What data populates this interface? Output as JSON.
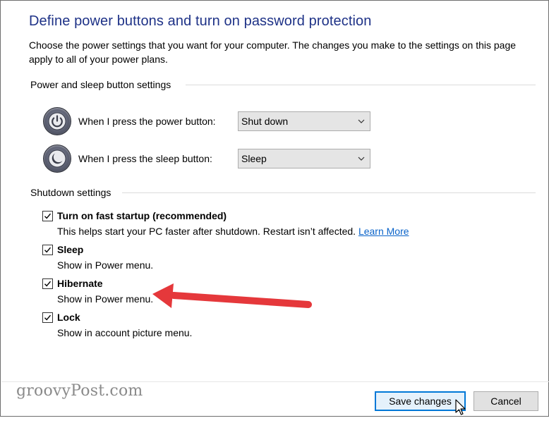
{
  "header": {
    "title": "Define power buttons and turn on password protection",
    "description": "Choose the power settings that you want for your computer. The changes you make to the settings on this page apply to all of your power plans."
  },
  "power_sleep": {
    "heading": "Power and sleep button settings",
    "power_button": {
      "label": "When I press the power button:",
      "value": "Shut down",
      "icon": "power-icon"
    },
    "sleep_button": {
      "label": "When I press the sleep button:",
      "value": "Sleep",
      "icon": "moon-icon"
    }
  },
  "shutdown": {
    "heading": "Shutdown settings",
    "items": [
      {
        "label": "Turn on fast startup (recommended)",
        "checked": true,
        "desc": "This helps start your PC faster after shutdown. Restart isn’t affected.",
        "link": "Learn More"
      },
      {
        "label": "Sleep",
        "checked": true,
        "desc": "Show in Power menu."
      },
      {
        "label": "Hibernate",
        "checked": true,
        "desc": "Show in Power menu."
      },
      {
        "label": "Lock",
        "checked": true,
        "desc": "Show in account picture menu."
      }
    ]
  },
  "footer": {
    "watermark": "groovyPost.com",
    "save_label": "Save changes",
    "cancel_label": "Cancel"
  },
  "colors": {
    "title": "#1e3287",
    "link": "#0a63c9",
    "annotation_arrow": "#e5383b"
  }
}
